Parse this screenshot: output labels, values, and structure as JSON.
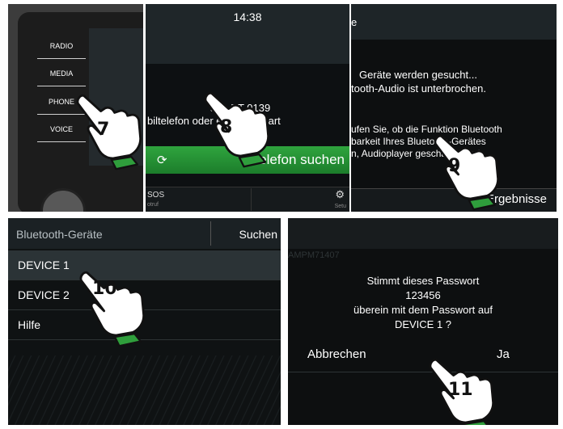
{
  "panel1": {
    "menu": [
      "RADIO",
      "MEDIA",
      "PHONE",
      "VOICE"
    ],
    "step": "7"
  },
  "panel2": {
    "clock": "14:38",
    "device_text": "ada BT 0139",
    "hint_text": "biltelefon        oder eine SIM-Kart",
    "search_button": "Telefon suchen",
    "sos_label": "SOS",
    "sos_sub": "otruf",
    "setup_label": "Setu",
    "step": "8"
  },
  "panel3": {
    "title": "e",
    "line1": "Geräte werden gesucht...",
    "line2": "tooth-Audio ist unterbrochen.",
    "line3": "ufen Sie, ob die Funktion Bluetooth",
    "line4": "barkeit Ihres        Bluetooth-Gerätes",
    "line5": "n, Audioplayer        geschaltet sind.",
    "results_button": "Ergebnisse",
    "step": "9"
  },
  "panel4": {
    "title": "Bluetooth-Geräte",
    "search_button": "Suchen",
    "items": [
      "DEVICE 1",
      "DEVICE 2",
      "Hilfe"
    ],
    "step": "10"
  },
  "panel5": {
    "ghost_text": "AMPM71407",
    "prompt_line1": "Stimmt dieses Passwort",
    "password": "123456",
    "prompt_line3": "überein mit dem Passwort auf",
    "device": "DEVICE 1 ?",
    "cancel_button": "Abbrechen",
    "confirm_button": "Ja",
    "step": "11"
  },
  "colors": {
    "accent_green": "#2fa43e",
    "hand_fill": "#ffffff",
    "hand_cuff": "#2f9e3c"
  }
}
